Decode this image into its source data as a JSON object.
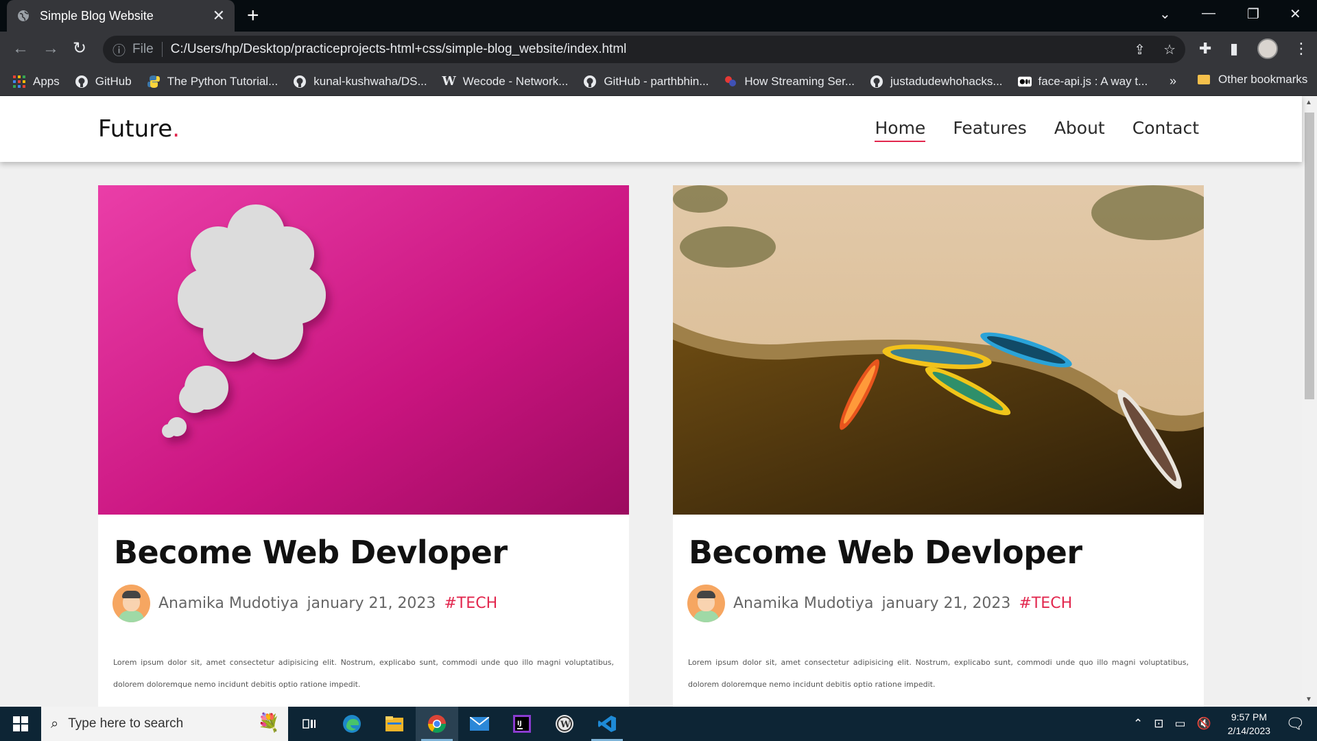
{
  "browser": {
    "tab_title": "Simple Blog Website",
    "tab_close": "✕",
    "new_tab": "+",
    "window_controls": {
      "tab_search": "⌄",
      "minimize": "—",
      "restore": "❐",
      "close": "✕"
    },
    "nav": {
      "back": "←",
      "forward": "→",
      "reload": "↻"
    },
    "omnibox": {
      "info_icon": "ⓘ",
      "scheme_label": "File",
      "url": "C:/Users/hp/Desktop/practiceprojects-html+css/simple-blog_website/index.html",
      "share_icon": "⇪",
      "star_icon": "☆"
    },
    "extensions_icon": "✚",
    "sidepanel_icon": "▮",
    "menu_icon": "⋮",
    "bookmarks": [
      {
        "label": "Apps",
        "icon": "apps-grid-icon"
      },
      {
        "label": "GitHub",
        "icon": "github-icon"
      },
      {
        "label": "The Python Tutorial...",
        "icon": "python-icon"
      },
      {
        "label": "kunal-kushwaha/DS...",
        "icon": "github-icon"
      },
      {
        "label": "Wecode - Network...",
        "icon": "wecode-icon"
      },
      {
        "label": "GitHub - parthbhin...",
        "icon": "github-icon"
      },
      {
        "label": "How Streaming Ser...",
        "icon": "streaming-icon"
      },
      {
        "label": "justadudewhohacks...",
        "icon": "github-icon"
      },
      {
        "label": "face-api.js : A way t...",
        "icon": "medium-icon"
      }
    ],
    "bookmarks_more": "»",
    "other_bookmarks": "Other bookmarks"
  },
  "site": {
    "logo": "Future",
    "logo_dot": ".",
    "nav": [
      "Home",
      "Features",
      "About",
      "Contact"
    ],
    "active_nav": "Home",
    "posts": [
      {
        "title": "Become Web Devloper",
        "author": "Anamika Mudotiya",
        "date": "january 21, 2023",
        "tag": "#TECH",
        "excerpt": "Lorem ipsum dolor sit, amet consectetur adipisicing elit. Nostrum, explicabo sunt, commodi unde quo illo magni voluptatibus, dolorem doloremque nemo incidunt debitis optio ratione impedit.",
        "image": "pink-thought-bubble"
      },
      {
        "title": "Become Web Devloper",
        "author": "Anamika Mudotiya",
        "date": "january 21, 2023",
        "tag": "#TECH",
        "excerpt": "Lorem ipsum dolor sit, amet consectetur adipisicing elit. Nostrum, explicabo sunt, commodi unde quo illo magni voluptatibus, dolorem doloremque nemo incidunt debitis optio ratione impedit.",
        "image": "aerial-beach-boats"
      }
    ],
    "accent_color": "#e2264d"
  },
  "taskbar": {
    "search_placeholder": "Type here to search",
    "apps": [
      "task-view-icon",
      "edge-icon",
      "file-explorer-icon",
      "chrome-icon",
      "mail-icon",
      "intellij-icon",
      "wordpress-icon",
      "vscode-icon"
    ],
    "time": "9:57 PM",
    "date": "2/14/2023"
  }
}
